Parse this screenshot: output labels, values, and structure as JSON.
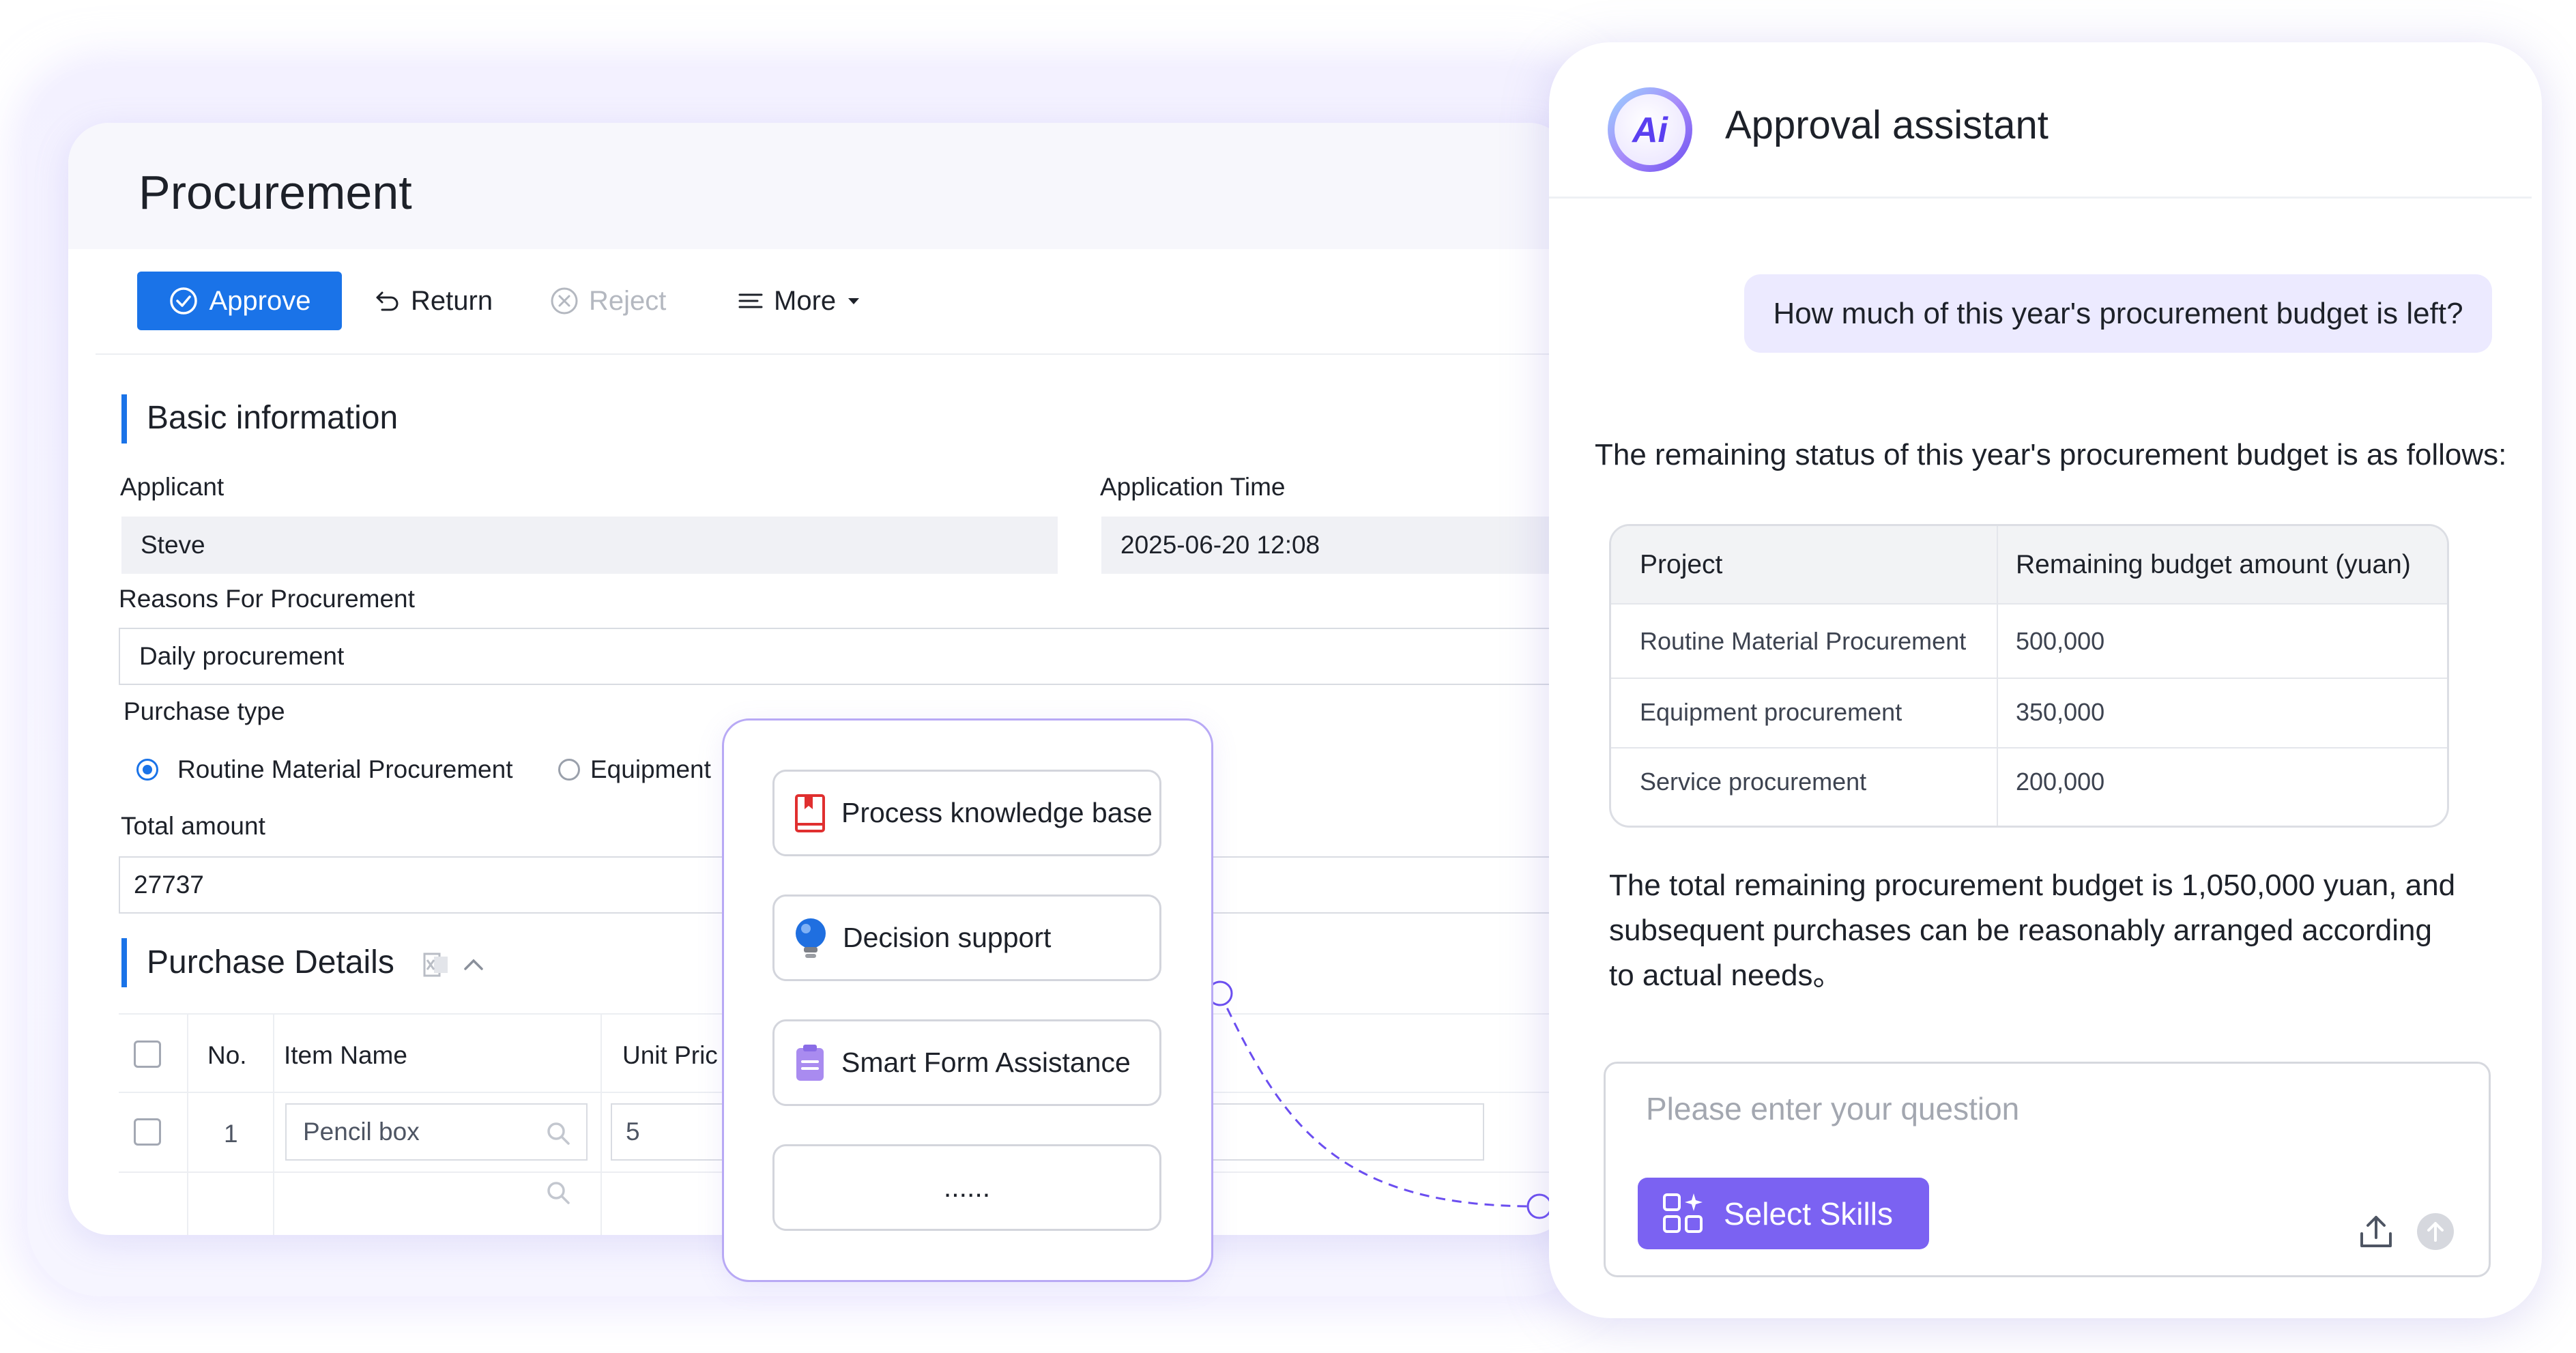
{
  "procurement": {
    "title": "Procurement",
    "toolbar": {
      "approve_label": "Approve",
      "return_label": "Return",
      "reject_label": "Reject",
      "more_label": "More"
    },
    "basic_info": {
      "section_title": "Basic information",
      "applicant_label": "Applicant",
      "applicant_value": "Steve",
      "application_time_label": "Application Time",
      "application_time_value": "2025-06-20 12:08",
      "reasons_label": "Reasons For Procurement",
      "reasons_value": "Daily procurement",
      "purchase_type_label": "Purchase type",
      "purchase_type_options": [
        "Routine Material Procurement",
        "Equipment"
      ],
      "purchase_type_selected": "Routine Material Procurement",
      "total_amount_label": "Total amount",
      "total_amount_value": "27737"
    },
    "purchase_details": {
      "section_title": "Purchase Details",
      "columns": [
        "No.",
        "Item Name",
        "Unit Pric"
      ],
      "rows": [
        {
          "no": "1",
          "item_name": "Pencil box",
          "unit_price": "5"
        }
      ]
    }
  },
  "skills_popup": {
    "items": [
      "Process knowledge base",
      "Decision support",
      "Smart Form Assistance",
      "......"
    ]
  },
  "assistant": {
    "logo_text": "Ai",
    "title": "Approval assistant",
    "user_message": "How much of this year's procurement budget is left?",
    "answer_intro": "The remaining status of this year's procurement budget is as follows:",
    "table": {
      "headers": [
        "Project",
        "Remaining budget amount (yuan)"
      ],
      "rows": [
        [
          "Routine Material Procurement",
          "500,000"
        ],
        [
          "Equipment procurement",
          "350,000"
        ],
        [
          "Service procurement",
          "200,000"
        ]
      ]
    },
    "summary": "The total remaining procurement budget is 1,050,000 yuan, and subsequent purchases can be reasonably arranged according to actual needs。",
    "input_placeholder": "Please enter your question",
    "input_value": "",
    "select_skills_label": "Select Skills"
  },
  "colors": {
    "primary_blue": "#1a73e8",
    "accent_purple": "#7b62f2",
    "bubble_bg": "#eceaff",
    "popup_border": "#b8a9f5"
  },
  "icons": [
    "check-circle-icon",
    "return-arrow-icon",
    "reject-x-icon",
    "menu-lines-icon",
    "caret-down-icon",
    "excel-icon",
    "chevron-up-icon",
    "search-icon",
    "book-icon",
    "lightbulb-icon",
    "clipboard-icon",
    "ai-logo-icon",
    "skills-grid-icon",
    "upload-icon",
    "send-icon"
  ]
}
